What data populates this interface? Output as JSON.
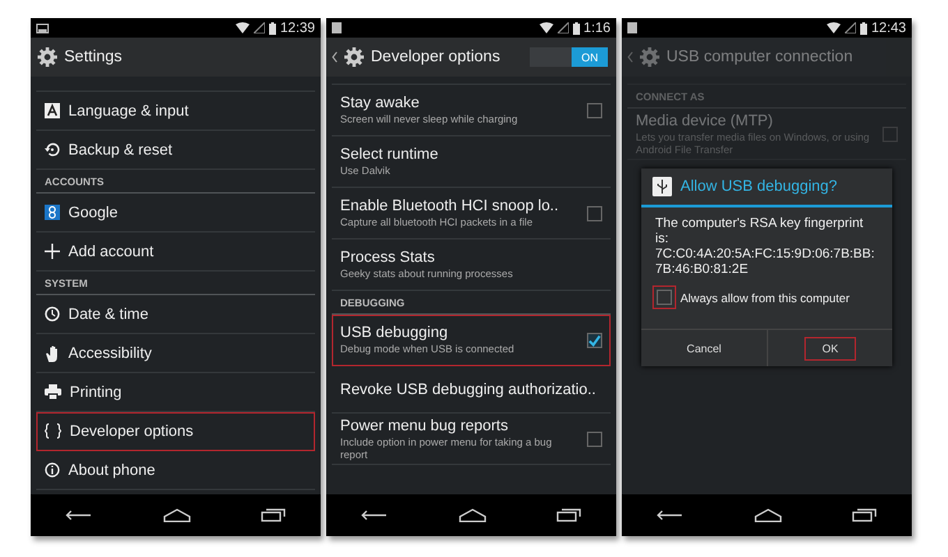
{
  "screens": [
    {
      "time": "12:39",
      "title": "Settings",
      "back": false,
      "items": [
        {
          "kind": "row",
          "label": "Language & input",
          "highlighted": false
        },
        {
          "kind": "row",
          "label": "Backup & reset",
          "highlighted": false
        },
        {
          "kind": "header",
          "label": "ACCOUNTS"
        },
        {
          "kind": "row",
          "label": "Google",
          "highlighted": false
        },
        {
          "kind": "row",
          "label": "Add account",
          "highlighted": false
        },
        {
          "kind": "header",
          "label": "SYSTEM"
        },
        {
          "kind": "row",
          "label": "Date & time",
          "highlighted": false
        },
        {
          "kind": "row",
          "label": "Accessibility",
          "highlighted": false
        },
        {
          "kind": "row",
          "label": "Printing",
          "highlighted": false
        },
        {
          "kind": "row",
          "label": "Developer options",
          "highlighted": true
        },
        {
          "kind": "row",
          "label": "About phone",
          "highlighted": false
        }
      ]
    },
    {
      "time": "1:16",
      "title": "Developer options",
      "back": true,
      "toggle": {
        "label": "ON",
        "on": true
      },
      "items": [
        {
          "kind": "check",
          "label": "Stay awake",
          "sub": "Screen will never sleep while charging",
          "checked": false,
          "highlighted": false
        },
        {
          "kind": "text",
          "label": "Select runtime",
          "sub": "Use Dalvik",
          "highlighted": false
        },
        {
          "kind": "check",
          "label": "Enable Bluetooth HCI snoop lo..",
          "sub": "Capture all bluetooth HCI packets in a file",
          "checked": false,
          "highlighted": false
        },
        {
          "kind": "text",
          "label": "Process Stats",
          "sub": "Geeky stats about running processes",
          "highlighted": false
        },
        {
          "kind": "header",
          "label": "DEBUGGING"
        },
        {
          "kind": "check",
          "label": "USB debugging",
          "sub": "Debug mode when USB is connected",
          "checked": true,
          "highlighted": true
        },
        {
          "kind": "text",
          "label": "Revoke USB debugging authorizatio..",
          "highlighted": false
        },
        {
          "kind": "check",
          "label": "Power menu bug reports",
          "sub": "Include option in power menu for taking a bug report",
          "checked": false,
          "highlighted": false
        }
      ]
    },
    {
      "time": "12:43",
      "title": "USB computer connection",
      "back": true,
      "dimmed": true,
      "items": [
        {
          "kind": "header",
          "label": "CONNECT AS"
        },
        {
          "kind": "check",
          "label": "Media device (MTP)",
          "sub": "Lets you transfer media files on Windows, or using Android File Transfer",
          "checked": false,
          "highlighted": false
        }
      ],
      "dialog": {
        "title": "Allow USB debugging?",
        "message": "The computer's RSA key fingerprint is: 7C:C0:4A:20:5A:FC:15:9D:06:7B:BB:7B:46:B0:81:2E",
        "checkbox": {
          "label": "Always allow from this computer",
          "checked": false,
          "highlighted": true
        },
        "buttons": [
          {
            "label": "Cancel",
            "highlighted": false
          },
          {
            "label": "OK",
            "highlighted": true
          }
        ]
      }
    }
  ]
}
